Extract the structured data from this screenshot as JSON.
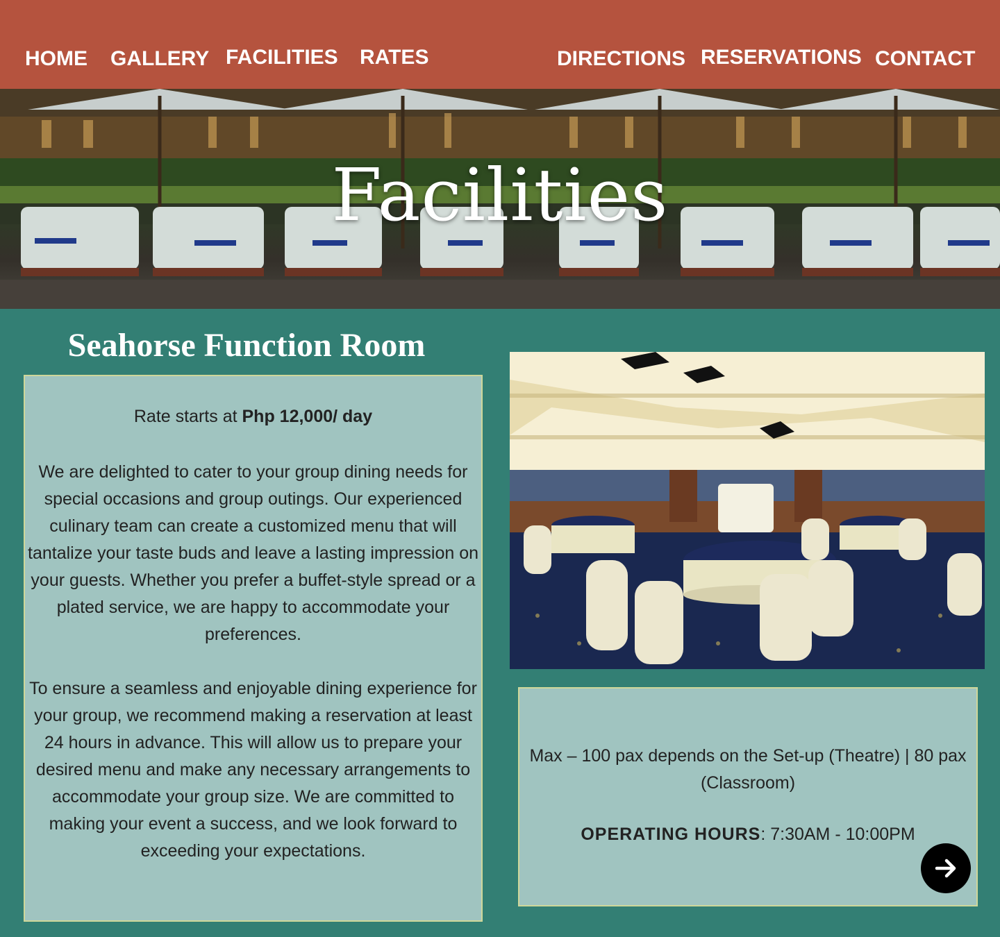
{
  "nav": {
    "home": "HOME",
    "gallery": "GALLERY",
    "facilities": "FACILITIES",
    "rates": "RATES",
    "directions": "DIRECTIONS",
    "reservations": "RESERVATIONS",
    "contact": "CONTACT"
  },
  "hero": {
    "title": "Facilities"
  },
  "room": {
    "title": "Seahorse Function Room",
    "rate_prefix": "Rate starts at ",
    "rate_value": "Php 12,000/ day",
    "paragraph_1": "We are delighted to cater to your group dining needs for special occasions and group outings. Our experienced culinary team can create a customized menu that will tantalize your taste buds and leave a lasting impression on your guests. Whether you prefer a buffet-style spread or a plated service, we are happy to accommodate your preferences.",
    "paragraph_2": "To ensure a seamless and enjoyable dining experience for your group, we recommend making a reservation at least 24 hours in advance. This will allow us to prepare your desired menu and make any necessary arrangements to accommodate your group size. We are committed to making your event a success, and we look forward to exceeding your expectations.",
    "capacity": "Max – 100 pax depends on the Set-up (Theatre) | 80 pax (Classroom)",
    "hours_label": "OPERATING HOURS",
    "hours_value": ": 7:30AM - 10:00PM"
  },
  "icons": {
    "next": "arrow-right-icon"
  },
  "colors": {
    "nav_bg": "#b5533e",
    "page_bg": "#337f74",
    "panel_bg": "#a0c4c0",
    "panel_border": "#cfd79a"
  }
}
